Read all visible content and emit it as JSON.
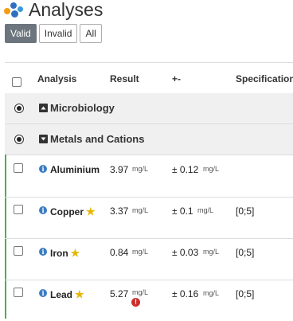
{
  "header": {
    "title": "Analyses",
    "logo_icon": "molecule-dots-icon"
  },
  "filters": [
    {
      "label": "Valid",
      "active": true
    },
    {
      "label": "Invalid",
      "active": false
    },
    {
      "label": "All",
      "active": false
    }
  ],
  "table": {
    "columns": {
      "analysis": "Analysis",
      "result": "Result",
      "uncertainty": "+-",
      "specification": "Specification"
    },
    "categories": [
      {
        "label": "Microbiology",
        "expanded": false
      },
      {
        "label": "Metals and Cations",
        "expanded": true
      }
    ],
    "rows": [
      {
        "name": "Aluminium",
        "starred": false,
        "result": "3.97",
        "unit": "mg/L",
        "uncertainty": "± 0.12",
        "unc_unit": "mg/L",
        "spec": "",
        "warning": false
      },
      {
        "name": "Copper",
        "starred": true,
        "result": "3.37",
        "unit": "mg/L",
        "uncertainty": "± 0.1",
        "unc_unit": "mg/L",
        "spec": "[0;5]",
        "warning": false
      },
      {
        "name": "Iron",
        "starred": true,
        "result": "0.84",
        "unit": "mg/L",
        "uncertainty": "± 0.03",
        "unc_unit": "mg/L",
        "spec": "[0;5]",
        "warning": false
      },
      {
        "name": "Lead",
        "starred": true,
        "result": "5.27",
        "unit": "mg/L",
        "uncertainty": "± 0.16",
        "unc_unit": "mg/L",
        "spec": "[0;5]",
        "warning": true
      }
    ]
  },
  "colors": {
    "accent_green": "#4caf50",
    "info_blue": "#3b7cc1",
    "warning_red": "#c9302c",
    "star": "#e5b800"
  }
}
